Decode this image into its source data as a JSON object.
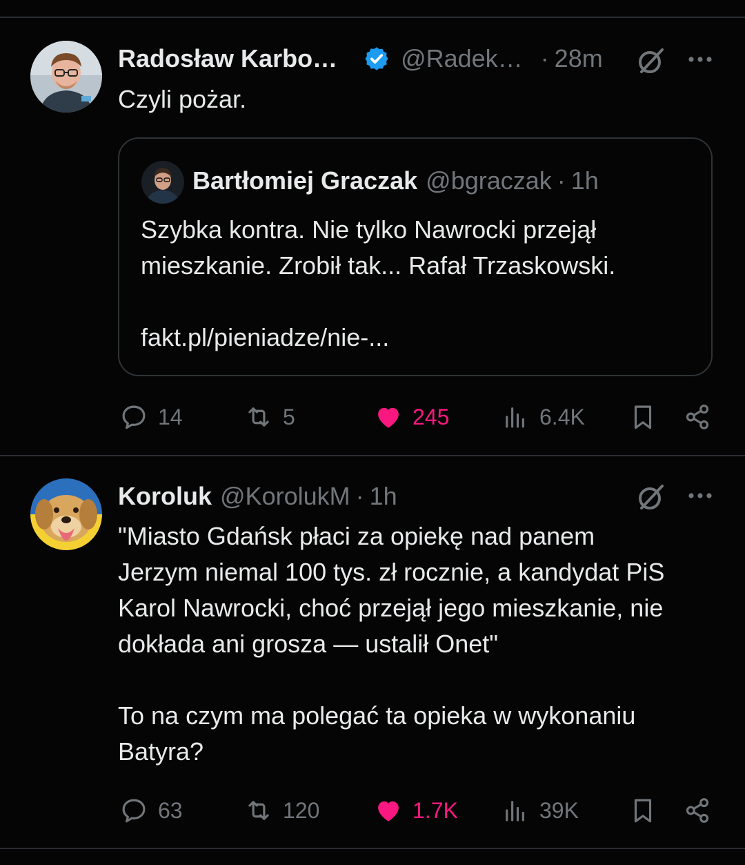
{
  "colors": {
    "background": "#050505",
    "text": "#e7e9ea",
    "muted": "#71767b",
    "like": "#f91880",
    "verified": "#1d9bf0",
    "border": "#2f3336"
  },
  "tweets": [
    {
      "author": "Radosław Karbo…",
      "verified": true,
      "handle": "@Radek…",
      "dot": "·",
      "time": "28m",
      "text": "Czyli pożar.",
      "quote": {
        "author": "Bartłomiej Graczak",
        "handle": "@bgraczak",
        "dot": "·",
        "time": "1h",
        "text": "Szybka kontra. Nie tylko Nawrocki przejął\nmieszkanie. Zrobił tak... Rafał Trzaskowski.\n\nfakt.pl/pieniadze/nie-..."
      },
      "stats": {
        "replies": "14",
        "reposts": "5",
        "likes": "245",
        "views": "6.4K"
      },
      "icons": [
        "grok-icon",
        "more-icon",
        "reply-icon",
        "repost-icon",
        "heart-icon",
        "views-icon",
        "bookmark-icon",
        "share-icon"
      ]
    },
    {
      "author": "Koroluk",
      "verified": false,
      "handle": "@KorolukM",
      "dot": "·",
      "time": "1h",
      "text": "\"Miasto Gdańsk płaci za opiekę nad panem\nJerzym niemal 100 tys. zł rocznie, a kandydat PiS\nKarol Nawrocki, choć przejął jego mieszkanie, nie\ndokłada ani grosza — ustalił Onet\"\n\nTo na czym ma polegać ta opieka w wykonaniu\nBatyra?",
      "stats": {
        "replies": "63",
        "reposts": "120",
        "likes": "1.7K",
        "views": "39K"
      },
      "icons": [
        "grok-icon",
        "more-icon",
        "reply-icon",
        "repost-icon",
        "heart-icon",
        "views-icon",
        "bookmark-icon",
        "share-icon"
      ]
    }
  ]
}
